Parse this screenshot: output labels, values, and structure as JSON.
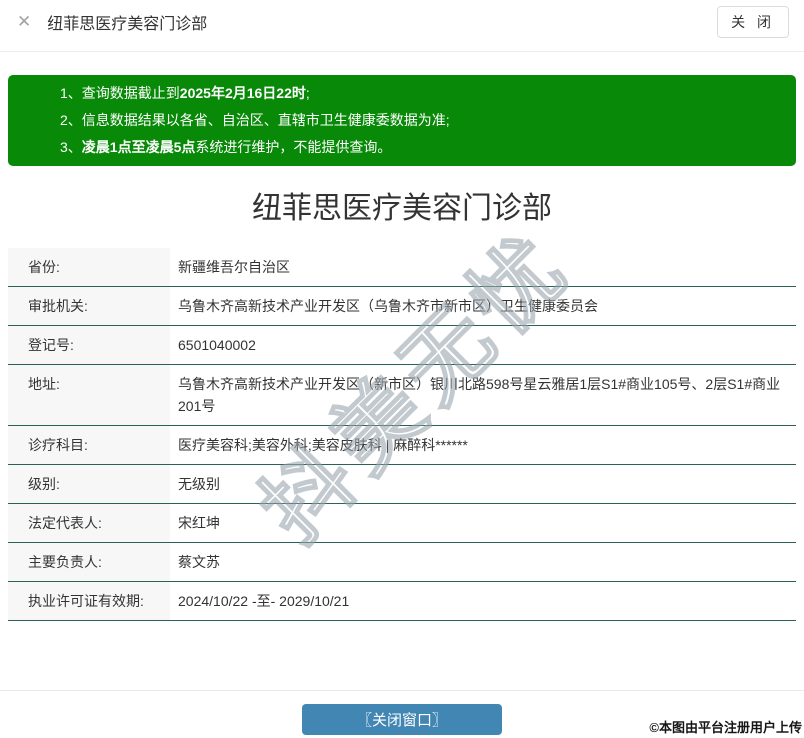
{
  "header": {
    "close_icon": "✕",
    "title": "纽菲思医疗美容门诊部",
    "close_button_label": "关 闭"
  },
  "notice": {
    "lines": [
      {
        "number": "1、",
        "text_before": "查询数据截止到",
        "text_bold": "2025年2月16日22时",
        "text_after": ";"
      },
      {
        "number": "2、",
        "text_before": "信息数据结果以各省、自治区、直辖市卫生健康委数据为准;",
        "text_bold": "",
        "text_after": ""
      },
      {
        "number": "3、",
        "text_before": "",
        "text_bold": "凌晨1点至凌晨5点",
        "text_after": "系统进行维护，不能提供查询。"
      }
    ]
  },
  "main": {
    "title": "纽菲思医疗美容门诊部"
  },
  "table": {
    "rows": [
      {
        "label": "省份:",
        "value": "新疆维吾尔自治区"
      },
      {
        "label": "审批机关:",
        "value": "乌鲁木齐高新技术产业开发区（乌鲁木齐市新市区）卫生健康委员会"
      },
      {
        "label": "登记号:",
        "value": "6501040002"
      },
      {
        "label": "地址:",
        "value": "乌鲁木齐高新技术产业开发区（新市区）银川北路598号星云雅居1层S1#商业105号、2层S1#商业201号"
      },
      {
        "label": "诊疗科目:",
        "value": "医疗美容科;美容外科;美容皮肤科 | 麻醉科******"
      },
      {
        "label": "级别:",
        "value": "无级别"
      },
      {
        "label": "法定代表人:",
        "value": "宋红坤"
      },
      {
        "label": "主要负责人:",
        "value": "蔡文苏"
      },
      {
        "label": "执业许可证有效期:",
        "value": "2024/10/22 -至- 2029/10/21"
      }
    ]
  },
  "watermark": {
    "diagonal_text": "抖美无忧",
    "copyright_text": "©本图由平台注册用户上传"
  },
  "footer": {
    "close_window_label": "〖关闭窗口〗"
  },
  "colors": {
    "notice_green": "#088A08",
    "close_window_button_blue": "#4286B4",
    "row_divider_teal": "#2A6158",
    "label_cell_bg": "#F7F7F7"
  }
}
